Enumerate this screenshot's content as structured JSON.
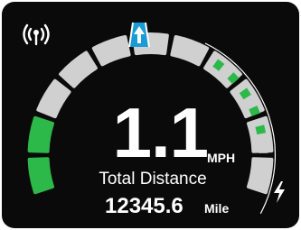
{
  "speed": {
    "value": "1.1",
    "unit": "MPH"
  },
  "distance": {
    "label": "Total Distance",
    "value": "12345.6",
    "unit": "Mile"
  },
  "icons": {
    "signal": "signal-broadcast-icon",
    "lane": "lane-straight-arrow-icon",
    "charge": "lightning-bolt-icon"
  },
  "gauge": {
    "segments_total": 11,
    "segments_lit_green": 2,
    "inner_segments_total": 6,
    "inner_segments_lit": 5
  },
  "colors": {
    "background": "#0a0a0a",
    "segment_off": "#d0d0d0",
    "segment_on": "#2db84a",
    "accent_blue": "#1a9bd7",
    "text": "#ffffff"
  }
}
